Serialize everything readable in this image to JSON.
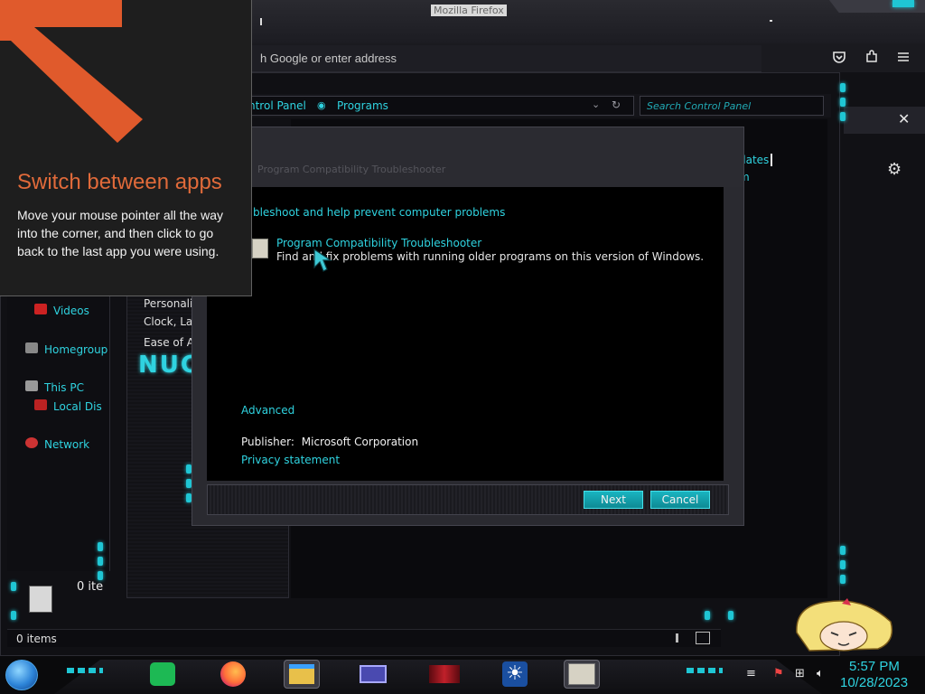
{
  "firefox": {
    "window_title": "Mozilla Firefox",
    "url_placeholder": "h Google or enter address"
  },
  "control_panel": {
    "breadcrumbs": [
      "ntrol Panel",
      "Programs"
    ],
    "search_placeholder": "Search Control Panel",
    "nav": {
      "videos": "Videos",
      "homegroup": "Homegroup",
      "this_pc": "This PC",
      "local_disk": "Local Dis",
      "network": "Network"
    },
    "middle": {
      "personalize": "Personaliz",
      "clock": "Clock, Lar",
      "ease": "Ease of Ac"
    },
    "right_links": [
      "dates",
      "m"
    ],
    "status_items": "0 items",
    "preview_count": "0 ite"
  },
  "dialog": {
    "title": "Program Compatibility Troubleshooter",
    "heading": "oubleshoot and help prevent computer problems",
    "item_title": "Program Compatibility Troubleshooter",
    "item_desc": "Find and fix problems with running older programs on this version of Windows.",
    "advanced": "Advanced",
    "publisher_label": "Publisher:",
    "publisher_value": "Microsoft Corporation",
    "privacy": "Privacy statement",
    "next": "Next",
    "cancel": "Cancel"
  },
  "tip": {
    "title": "Switch between apps",
    "body": "Move your mouse pointer all the way into the corner, and then click to go back to the last app you were using."
  },
  "taskbar": {
    "apps": [
      {
        "name": "spotify-icon",
        "color": "#1db954"
      },
      {
        "name": "firefox-icon",
        "color": "#ff7139"
      },
      {
        "name": "file-explorer-icon",
        "color": "#e8c04a"
      },
      {
        "name": "control-panel-icon",
        "color": "#6b6bd6"
      },
      {
        "name": "game-icon",
        "color": "#c0202a"
      },
      {
        "name": "settings-sun-icon",
        "color": "#3aa0ff"
      },
      {
        "name": "troubleshooter-icon",
        "color": "#d6d2c4"
      }
    ],
    "time": "5:57 PM",
    "date": "10/28/2023"
  },
  "colors": {
    "accent": "#2fd3e0",
    "tip_orange": "#e06a3a"
  }
}
